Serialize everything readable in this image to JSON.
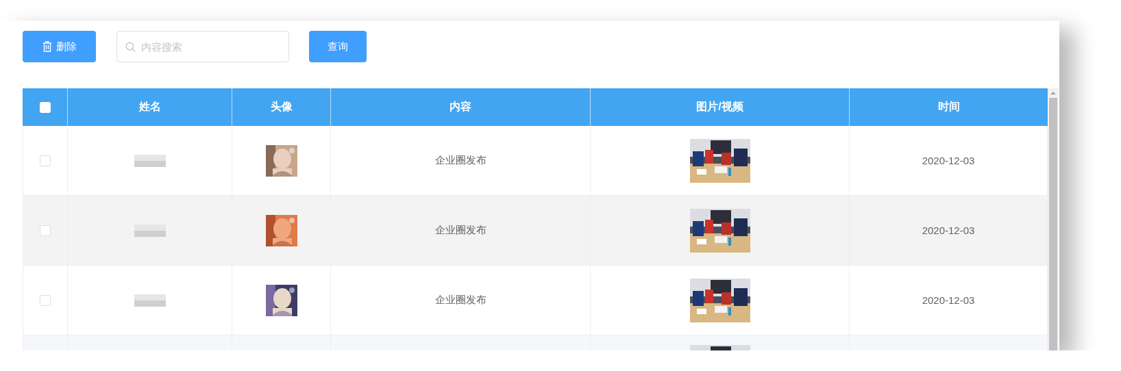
{
  "toolbar": {
    "delete_button": "删除",
    "search": {
      "placeholder": "内容搜索"
    },
    "query_button": "查询"
  },
  "table": {
    "header_checkbox": {
      "checked": false
    },
    "columns": [
      "姓名",
      "头像",
      "内容",
      "图片/视频",
      "时间"
    ],
    "rows": [
      {
        "checked": false,
        "avatar": {
          "kind": "picture"
        },
        "content": "企业圈发布",
        "media": {
          "kind": "picture"
        },
        "time": "2020-12-03"
      },
      {
        "checked": false,
        "avatar": {
          "kind": "picture"
        },
        "content": "企业圈发布",
        "media": {
          "kind": "picture"
        },
        "time": "2020-12-03"
      },
      {
        "checked": false,
        "avatar": {
          "kind": "picture"
        },
        "content": "企业圈发布",
        "media": {
          "kind": "picture"
        },
        "time": "2020-12-03"
      },
      {
        "media": {
          "kind": "picture"
        }
      }
    ]
  }
}
